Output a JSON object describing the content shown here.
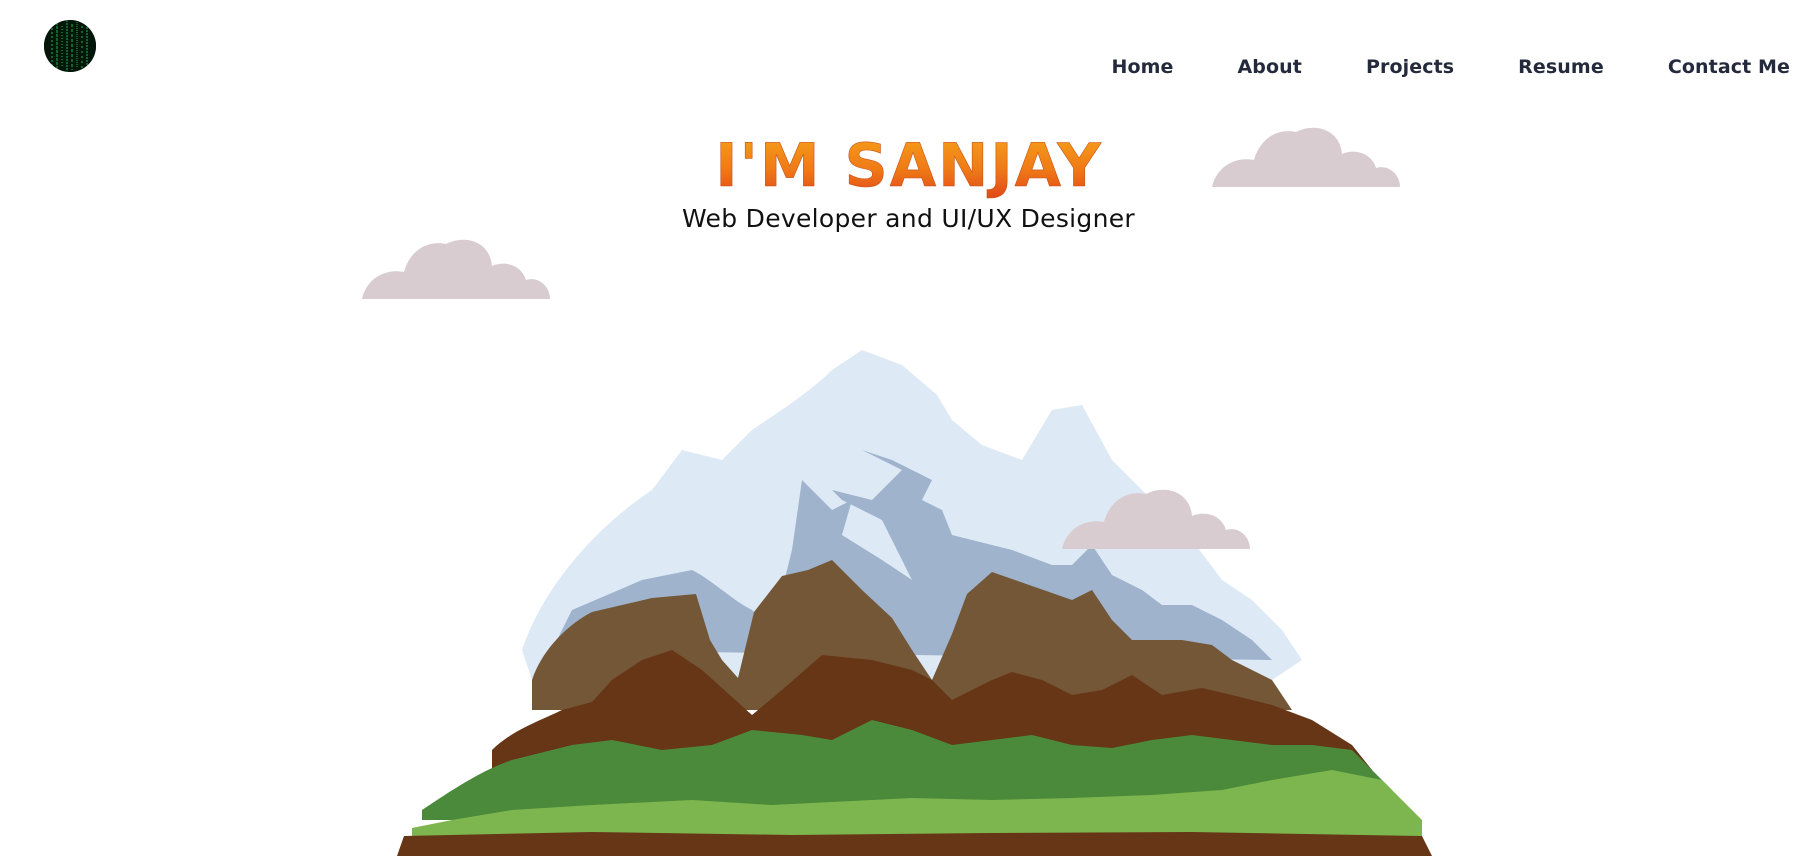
{
  "header": {
    "logo": {
      "icon": "matrix-code-avatar-icon"
    },
    "nav": [
      {
        "label": "Home"
      },
      {
        "label": "About"
      },
      {
        "label": "Projects"
      },
      {
        "label": "Resume"
      },
      {
        "label": "Contact Me"
      }
    ]
  },
  "hero": {
    "title": "I'M SANJAY",
    "subtitle": "Web Developer and UI/UX Designer"
  },
  "colors": {
    "nav_text": "#242a3c",
    "title_gradient_top": "#f6a21a",
    "title_gradient_bottom": "#e0421a",
    "cloud": "#d8ccd1",
    "snow": "#dde9f5",
    "snow_shadow": "#9fb3cc",
    "rock_light": "#735737",
    "rock_dark": "#663617",
    "grass_dark": "#4b8a3a",
    "grass_light": "#7db64e"
  },
  "illustration": {
    "icons": [
      "cloud-icon",
      "mountain-illustration"
    ]
  }
}
